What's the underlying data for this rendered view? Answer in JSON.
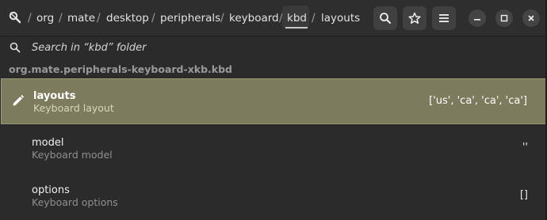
{
  "header": {
    "breadcrumbs": [
      "/",
      "org",
      "/",
      "mate",
      "/",
      "desktop",
      "/",
      "peripherals",
      "/",
      "keyboard",
      "/",
      "kbd",
      "/",
      "layouts"
    ],
    "active_crumb": "kbd",
    "buttons": [
      "search-icon",
      "star-icon",
      "menu-icon"
    ],
    "window_controls": [
      "minimize-icon",
      "maximize-icon",
      "close-icon"
    ]
  },
  "search": {
    "placeholder": "Search in “kbd” folder"
  },
  "schema": "org.mate.peripherals-keyboard-xkb.kbd",
  "rows": [
    {
      "title": "layouts",
      "subtitle": "Keyboard layout",
      "value": "['us', 'ca', 'ca', 'ca']",
      "selected": true
    },
    {
      "title": "model",
      "subtitle": "Keyboard model",
      "value": "''",
      "selected": false
    },
    {
      "title": "options",
      "subtitle": "Keyboard options",
      "value": "[]",
      "selected": false
    }
  ],
  "colors": {
    "background": "#2b2b2b",
    "selected_row": "#7d7b5d",
    "header_button": "#404040"
  }
}
